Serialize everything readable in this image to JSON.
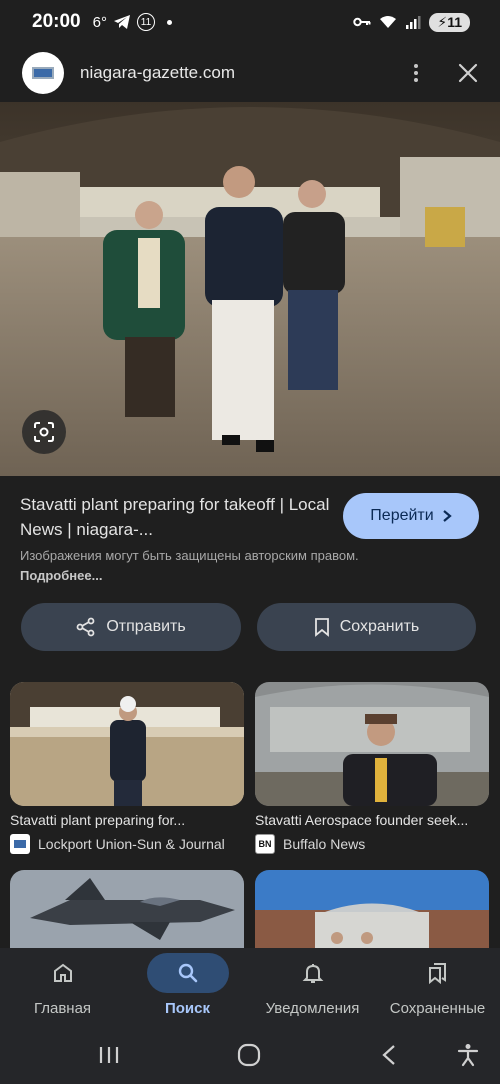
{
  "status_bar": {
    "time": "20:00",
    "temperature": "6°",
    "notif_count": "11",
    "battery": "11"
  },
  "site": {
    "domain": "niagara-gazette.com"
  },
  "result": {
    "title": "Stavatti plant preparing for takeoff | Local News | niagara-...",
    "go_label": "Перейти",
    "copyright_text": "Изображения могут быть защищены авторским правом.",
    "more_link": "Подробнее..."
  },
  "actions": {
    "share_label": "Отправить",
    "save_label": "Сохранить"
  },
  "related": [
    {
      "title": "Stavatti plant preparing for...",
      "source": "Lockport Union-Sun & Journal"
    },
    {
      "title": "Stavatti Aerospace founder seek...",
      "source": "Buffalo News",
      "source_badge": "BN"
    },
    {
      "title": "",
      "source": ""
    },
    {
      "title": "",
      "source": ""
    }
  ],
  "bottom_nav": {
    "items": [
      {
        "label": "Главная",
        "icon": "home-icon"
      },
      {
        "label": "Поиск",
        "icon": "search-icon",
        "active": true
      },
      {
        "label": "Уведомления",
        "icon": "bell-icon"
      },
      {
        "label": "Сохраненные",
        "icon": "bookmarks-icon"
      }
    ]
  },
  "colors": {
    "background": "#1f1f1f",
    "accent": "#a8c7fa",
    "chip_bg": "#3a4350",
    "nav_active": "#2f4d74"
  }
}
